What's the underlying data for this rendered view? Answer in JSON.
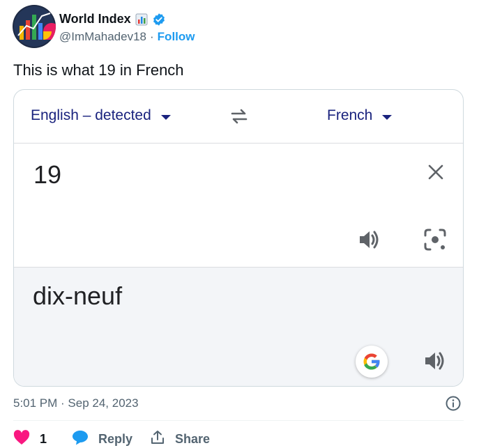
{
  "author": {
    "name": "World Index",
    "name_emoji_icon": "bar-chart-emoji-icon",
    "verified_icon": "verified-badge-icon",
    "handle": "@ImMahadev18",
    "separator": "·",
    "follow_label": "Follow"
  },
  "tweet": {
    "text": "This is what 19 in French"
  },
  "translate_card": {
    "source_language": "English – detected",
    "target_language": "French",
    "swap_icon": "swap-arrows-icon",
    "source_text": "19",
    "translated_text": "dix-neuf",
    "icons": [
      "close-icon",
      "speaker-icon",
      "camera-lens-icon",
      "google-g-icon",
      "speaker-icon"
    ]
  },
  "meta": {
    "timestamp": "5:01 PM · Sep 24, 2023"
  },
  "actions": {
    "like_count": "1",
    "reply_label": "Reply",
    "share_label": "Share"
  },
  "colors": {
    "link_blue": "#1d9bf0",
    "language_blue": "#1a237e",
    "like_pink": "#f91880",
    "reply_blue": "#1d9bf0",
    "secondary_text": "#536471"
  }
}
